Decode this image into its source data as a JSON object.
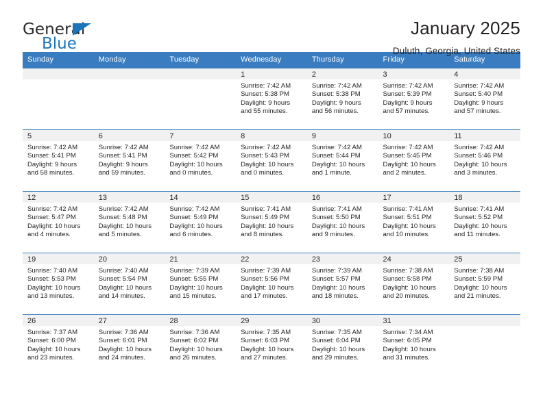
{
  "brand": {
    "name_part1": "General",
    "name_part2": "Blue",
    "accent_color": "#1b75bb"
  },
  "header": {
    "title": "January 2025",
    "subtitle": "Duluth, Georgia, United States",
    "header_bg_color": "#3a7cc0",
    "daynum_band_color": "#f1f1f1"
  },
  "weekdays": [
    "Sunday",
    "Monday",
    "Tuesday",
    "Wednesday",
    "Thursday",
    "Friday",
    "Saturday"
  ],
  "weeks": [
    [
      {
        "day": "",
        "lines": []
      },
      {
        "day": "",
        "lines": []
      },
      {
        "day": "",
        "lines": []
      },
      {
        "day": "1",
        "lines": [
          "Sunrise: 7:42 AM",
          "Sunset: 5:38 PM",
          "Daylight: 9 hours",
          "and 55 minutes."
        ]
      },
      {
        "day": "2",
        "lines": [
          "Sunrise: 7:42 AM",
          "Sunset: 5:38 PM",
          "Daylight: 9 hours",
          "and 56 minutes."
        ]
      },
      {
        "day": "3",
        "lines": [
          "Sunrise: 7:42 AM",
          "Sunset: 5:39 PM",
          "Daylight: 9 hours",
          "and 57 minutes."
        ]
      },
      {
        "day": "4",
        "lines": [
          "Sunrise: 7:42 AM",
          "Sunset: 5:40 PM",
          "Daylight: 9 hours",
          "and 57 minutes."
        ]
      }
    ],
    [
      {
        "day": "5",
        "lines": [
          "Sunrise: 7:42 AM",
          "Sunset: 5:41 PM",
          "Daylight: 9 hours",
          "and 58 minutes."
        ]
      },
      {
        "day": "6",
        "lines": [
          "Sunrise: 7:42 AM",
          "Sunset: 5:41 PM",
          "Daylight: 9 hours",
          "and 59 minutes."
        ]
      },
      {
        "day": "7",
        "lines": [
          "Sunrise: 7:42 AM",
          "Sunset: 5:42 PM",
          "Daylight: 10 hours",
          "and 0 minutes."
        ]
      },
      {
        "day": "8",
        "lines": [
          "Sunrise: 7:42 AM",
          "Sunset: 5:43 PM",
          "Daylight: 10 hours",
          "and 0 minutes."
        ]
      },
      {
        "day": "9",
        "lines": [
          "Sunrise: 7:42 AM",
          "Sunset: 5:44 PM",
          "Daylight: 10 hours",
          "and 1 minute."
        ]
      },
      {
        "day": "10",
        "lines": [
          "Sunrise: 7:42 AM",
          "Sunset: 5:45 PM",
          "Daylight: 10 hours",
          "and 2 minutes."
        ]
      },
      {
        "day": "11",
        "lines": [
          "Sunrise: 7:42 AM",
          "Sunset: 5:46 PM",
          "Daylight: 10 hours",
          "and 3 minutes."
        ]
      }
    ],
    [
      {
        "day": "12",
        "lines": [
          "Sunrise: 7:42 AM",
          "Sunset: 5:47 PM",
          "Daylight: 10 hours",
          "and 4 minutes."
        ]
      },
      {
        "day": "13",
        "lines": [
          "Sunrise: 7:42 AM",
          "Sunset: 5:48 PM",
          "Daylight: 10 hours",
          "and 5 minutes."
        ]
      },
      {
        "day": "14",
        "lines": [
          "Sunrise: 7:42 AM",
          "Sunset: 5:49 PM",
          "Daylight: 10 hours",
          "and 6 minutes."
        ]
      },
      {
        "day": "15",
        "lines": [
          "Sunrise: 7:41 AM",
          "Sunset: 5:49 PM",
          "Daylight: 10 hours",
          "and 8 minutes."
        ]
      },
      {
        "day": "16",
        "lines": [
          "Sunrise: 7:41 AM",
          "Sunset: 5:50 PM",
          "Daylight: 10 hours",
          "and 9 minutes."
        ]
      },
      {
        "day": "17",
        "lines": [
          "Sunrise: 7:41 AM",
          "Sunset: 5:51 PM",
          "Daylight: 10 hours",
          "and 10 minutes."
        ]
      },
      {
        "day": "18",
        "lines": [
          "Sunrise: 7:41 AM",
          "Sunset: 5:52 PM",
          "Daylight: 10 hours",
          "and 11 minutes."
        ]
      }
    ],
    [
      {
        "day": "19",
        "lines": [
          "Sunrise: 7:40 AM",
          "Sunset: 5:53 PM",
          "Daylight: 10 hours",
          "and 13 minutes."
        ]
      },
      {
        "day": "20",
        "lines": [
          "Sunrise: 7:40 AM",
          "Sunset: 5:54 PM",
          "Daylight: 10 hours",
          "and 14 minutes."
        ]
      },
      {
        "day": "21",
        "lines": [
          "Sunrise: 7:39 AM",
          "Sunset: 5:55 PM",
          "Daylight: 10 hours",
          "and 15 minutes."
        ]
      },
      {
        "day": "22",
        "lines": [
          "Sunrise: 7:39 AM",
          "Sunset: 5:56 PM",
          "Daylight: 10 hours",
          "and 17 minutes."
        ]
      },
      {
        "day": "23",
        "lines": [
          "Sunrise: 7:39 AM",
          "Sunset: 5:57 PM",
          "Daylight: 10 hours",
          "and 18 minutes."
        ]
      },
      {
        "day": "24",
        "lines": [
          "Sunrise: 7:38 AM",
          "Sunset: 5:58 PM",
          "Daylight: 10 hours",
          "and 20 minutes."
        ]
      },
      {
        "day": "25",
        "lines": [
          "Sunrise: 7:38 AM",
          "Sunset: 5:59 PM",
          "Daylight: 10 hours",
          "and 21 minutes."
        ]
      }
    ],
    [
      {
        "day": "26",
        "lines": [
          "Sunrise: 7:37 AM",
          "Sunset: 6:00 PM",
          "Daylight: 10 hours",
          "and 23 minutes."
        ]
      },
      {
        "day": "27",
        "lines": [
          "Sunrise: 7:36 AM",
          "Sunset: 6:01 PM",
          "Daylight: 10 hours",
          "and 24 minutes."
        ]
      },
      {
        "day": "28",
        "lines": [
          "Sunrise: 7:36 AM",
          "Sunset: 6:02 PM",
          "Daylight: 10 hours",
          "and 26 minutes."
        ]
      },
      {
        "day": "29",
        "lines": [
          "Sunrise: 7:35 AM",
          "Sunset: 6:03 PM",
          "Daylight: 10 hours",
          "and 27 minutes."
        ]
      },
      {
        "day": "30",
        "lines": [
          "Sunrise: 7:35 AM",
          "Sunset: 6:04 PM",
          "Daylight: 10 hours",
          "and 29 minutes."
        ]
      },
      {
        "day": "31",
        "lines": [
          "Sunrise: 7:34 AM",
          "Sunset: 6:05 PM",
          "Daylight: 10 hours",
          "and 31 minutes."
        ]
      },
      {
        "day": "",
        "lines": []
      }
    ]
  ]
}
